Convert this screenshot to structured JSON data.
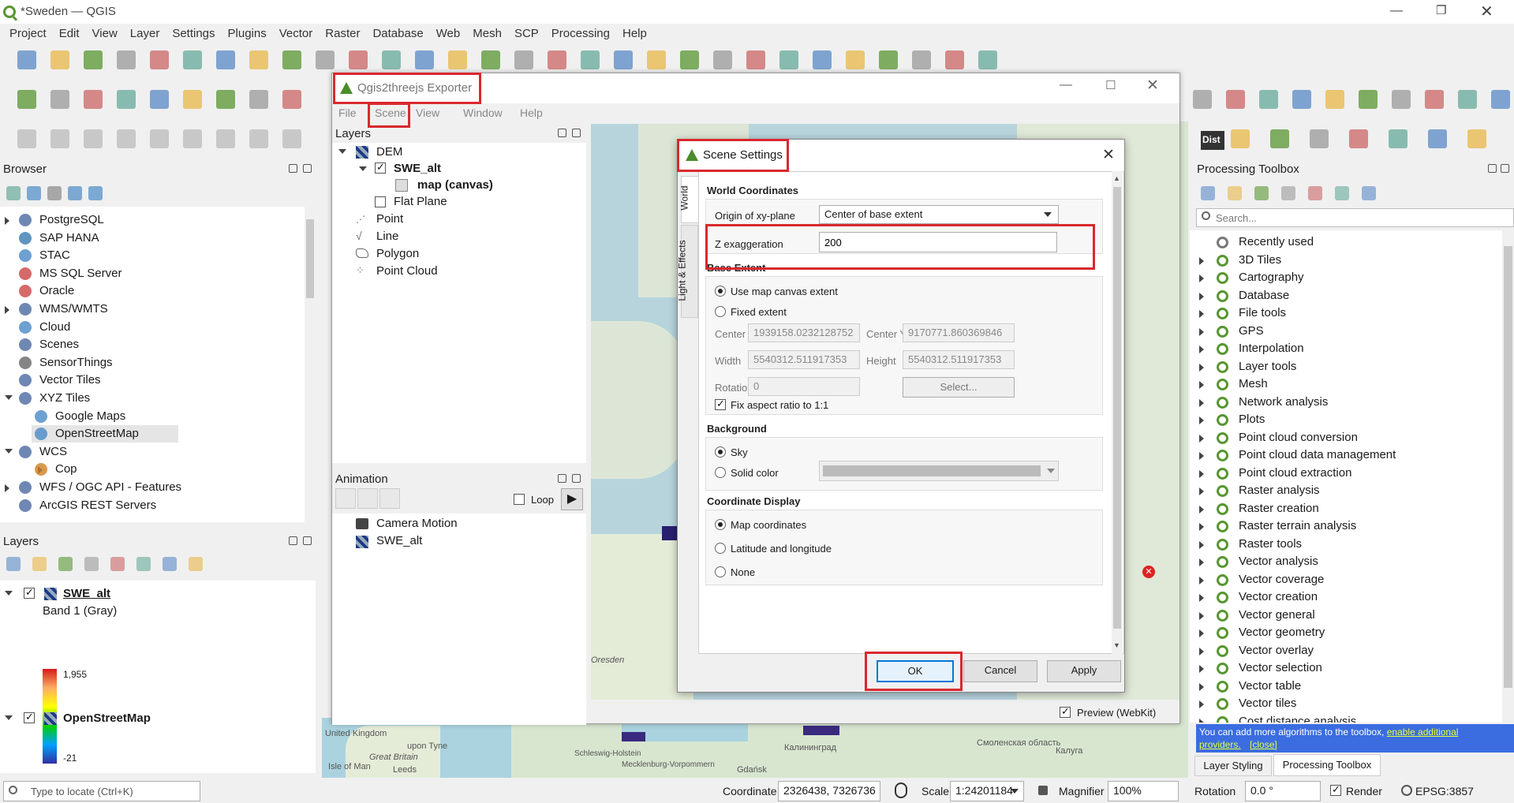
{
  "app": {
    "title": "*Sweden — QGIS",
    "menu": [
      "Project",
      "Edit",
      "View",
      "Layer",
      "Settings",
      "Plugins",
      "Vector",
      "Raster",
      "Database",
      "Web",
      "Mesh",
      "SCP",
      "Processing",
      "Help"
    ]
  },
  "browser": {
    "title": "Browser",
    "items": [
      {
        "label": "PostgreSQL",
        "level": 0,
        "arrow": "right"
      },
      {
        "label": "SAP HANA",
        "level": 0,
        "arrow": ""
      },
      {
        "label": "STAC",
        "level": 0,
        "arrow": ""
      },
      {
        "label": "MS SQL Server",
        "level": 0,
        "arrow": ""
      },
      {
        "label": "Oracle",
        "level": 0,
        "arrow": ""
      },
      {
        "label": "WMS/WMTS",
        "level": 0,
        "arrow": "right"
      },
      {
        "label": "Cloud",
        "level": 0,
        "arrow": ""
      },
      {
        "label": "Scenes",
        "level": 0,
        "arrow": ""
      },
      {
        "label": "SensorThings",
        "level": 0,
        "arrow": ""
      },
      {
        "label": "Vector Tiles",
        "level": 0,
        "arrow": ""
      },
      {
        "label": "XYZ Tiles",
        "level": 0,
        "arrow": "down"
      },
      {
        "label": "Google Maps",
        "level": 1,
        "arrow": ""
      },
      {
        "label": "OpenStreetMap",
        "level": 1,
        "arrow": ""
      },
      {
        "label": "WCS",
        "level": 0,
        "arrow": "down"
      },
      {
        "label": "Cop",
        "level": 1,
        "arrow": "right"
      },
      {
        "label": "WFS / OGC API - Features",
        "level": 0,
        "arrow": "right"
      },
      {
        "label": "ArcGIS REST Servers",
        "level": 0,
        "arrow": ""
      }
    ]
  },
  "layers": {
    "title": "Layers",
    "swe_alt": "SWE_alt",
    "band": "Band 1 (Gray)",
    "max": "1,955",
    "min": "-21",
    "osm": "OpenStreetMap"
  },
  "exporter": {
    "title": "Qgis2threejs Exporter",
    "menu": [
      "File",
      "Scene",
      "View",
      "Window",
      "Help"
    ],
    "layers_title": "Layers",
    "dem": "DEM",
    "swe_alt": "SWE_alt",
    "map_canvas": "map (canvas)",
    "flat_plane": "Flat Plane",
    "point": "Point",
    "line": "Line",
    "polygon": "Polygon",
    "point_cloud": "Point Cloud",
    "animation_title": "Animation",
    "loop": "Loop",
    "camera_motion": "Camera Motion",
    "anim_swe": "SWE_alt",
    "preview": "Preview (WebKit)"
  },
  "scene_settings": {
    "title": "Scene Settings",
    "tabs": [
      "World",
      "Light & Effects"
    ],
    "world_coords": "World Coordinates",
    "origin_label": "Origin of xy-plane",
    "origin_value": "Center of base extent",
    "z_label": "Z exaggeration",
    "z_value": "200",
    "base_extent": "Base Extent",
    "use_canvas": "Use map canvas extent",
    "fixed_extent": "Fixed extent",
    "center_x_label": "Center X",
    "center_x": "1939158.0232128752",
    "center_y_label": "Center Y",
    "center_y": "9170771.860369846",
    "width_label": "Width",
    "width": "5540312.511917353",
    "height_label": "Height",
    "height": "5540312.511917353",
    "rotation_label": "Rotation",
    "rotation": "0",
    "select_btn": "Select...",
    "fix_aspect": "Fix aspect ratio to 1:1",
    "background": "Background",
    "sky": "Sky",
    "solid_color": "Solid color",
    "coord_display": "Coordinate Display",
    "map_coords": "Map coordinates",
    "latlon": "Latitude and longitude",
    "none": "None",
    "ok": "OK",
    "cancel": "Cancel",
    "apply": "Apply"
  },
  "processing": {
    "title": "Processing Toolbox",
    "search_placeholder": "Search...",
    "items": [
      "Recently used",
      "3D Tiles",
      "Cartography",
      "Database",
      "File tools",
      "GPS",
      "Interpolation",
      "Layer tools",
      "Mesh",
      "Network analysis",
      "Plots",
      "Point cloud conversion",
      "Point cloud data management",
      "Point cloud extraction",
      "Raster analysis",
      "Raster creation",
      "Raster terrain analysis",
      "Raster tools",
      "Vector analysis",
      "Vector coverage",
      "Vector creation",
      "Vector general",
      "Vector geometry",
      "Vector overlay",
      "Vector selection",
      "Vector table",
      "Vector tiles",
      "Cost distance analysis"
    ],
    "notice_prefix": "You can add more algorithms to the toolbox, ",
    "notice_link": "enable additional",
    "notice_link2": "providers.",
    "notice_close": "[close]",
    "tab_styling": "Layer Styling",
    "tab_toolbox": "Processing Toolbox"
  },
  "map_labels": [
    "Gdańsk",
    "Калининград",
    "United Kingdom",
    "Great Britain",
    "Isle of Man",
    "Leeds",
    "upon Tyne",
    "Schleswig-Holstein",
    "Mecklenburg-Vorpommern",
    "Oresden",
    "Смоленская область",
    "Калуга",
    "Dist"
  ],
  "statusbar": {
    "locate_placeholder": "Type to locate (Ctrl+K)",
    "coordinate_label": "Coordinate",
    "coordinate": "2326438, 7326736",
    "scale_label": "Scale",
    "scale": "1:24201184",
    "magnifier_label": "Magnifier",
    "magnifier": "100%",
    "rotation_label": "Rotation",
    "rotation": "0.0 °",
    "render": "Render",
    "epsg": "EPSG:3857"
  },
  "colors": {
    "qgis_green": "#589632",
    "highlight": "#d9282f",
    "link": "#0000ee",
    "notice_bg": "#3b6de0"
  }
}
